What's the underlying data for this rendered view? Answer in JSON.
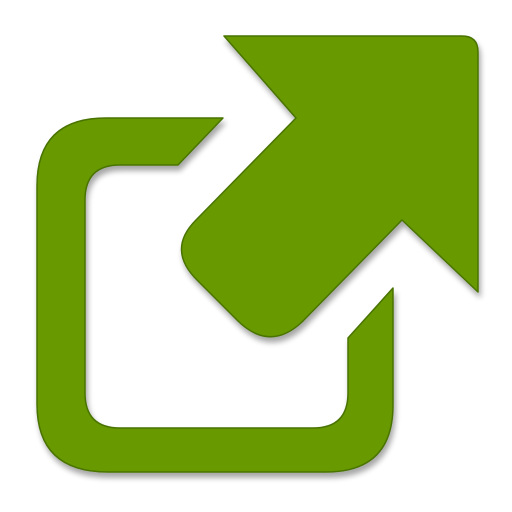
{
  "icon": {
    "name": "external-link-icon",
    "colors": {
      "fill": "#679a01",
      "highlight": "#7fb51c",
      "shadow": "#4a7300",
      "background": "#ffffff"
    }
  }
}
